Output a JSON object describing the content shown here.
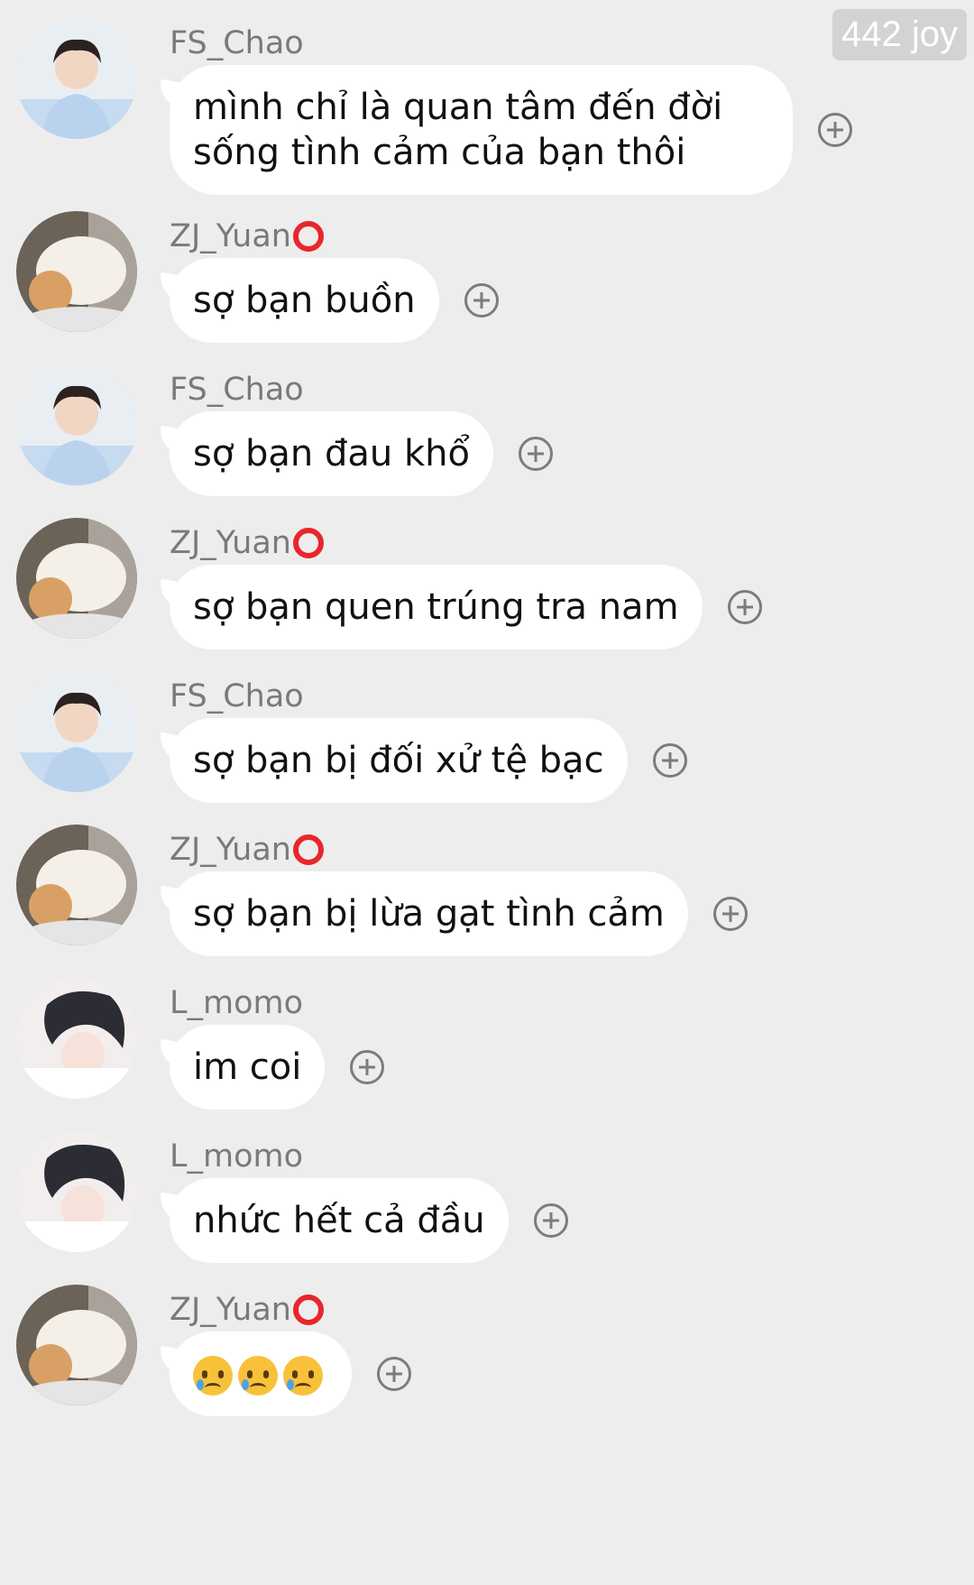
{
  "watermark": "442 joy",
  "messages": [
    {
      "user": "FS_Chao",
      "badge": false,
      "avatar": "avatar-boy-blue-sweater",
      "lines": [
        "mình chỉ là quan tâm đến đời",
        "sống tình cảm của bạn thôi"
      ]
    },
    {
      "user": "ZJ_Yuan",
      "badge": true,
      "avatar": "avatar-cat",
      "lines": [
        "sợ bạn buồn"
      ]
    },
    {
      "user": "FS_Chao",
      "badge": false,
      "avatar": "avatar-boy-blue-sweater",
      "lines": [
        "sợ bạn đau khổ"
      ]
    },
    {
      "user": "ZJ_Yuan",
      "badge": true,
      "avatar": "avatar-cat",
      "lines": [
        "sợ bạn quen trúng tra nam"
      ]
    },
    {
      "user": "FS_Chao",
      "badge": false,
      "avatar": "avatar-boy-blue-sweater",
      "lines": [
        "sợ bạn bị đối xử tệ bạc"
      ]
    },
    {
      "user": "ZJ_Yuan",
      "badge": true,
      "avatar": "avatar-cat",
      "lines": [
        "sợ bạn bị lừa gạt tình cảm"
      ]
    },
    {
      "user": "L_momo",
      "badge": false,
      "avatar": "avatar-boy-white",
      "lines": [
        "im coi"
      ]
    },
    {
      "user": "L_momo",
      "badge": false,
      "avatar": "avatar-boy-white",
      "lines": [
        "nhức hết cả đầu"
      ]
    },
    {
      "user": "ZJ_Yuan",
      "badge": true,
      "avatar": "avatar-cat",
      "lines": [],
      "emoji": [
        "crying-face-emoji",
        "crying-face-emoji",
        "crying-face-emoji"
      ]
    }
  ],
  "icons": {
    "add": "plus-circle-icon",
    "badge": "red-circle-icon"
  }
}
